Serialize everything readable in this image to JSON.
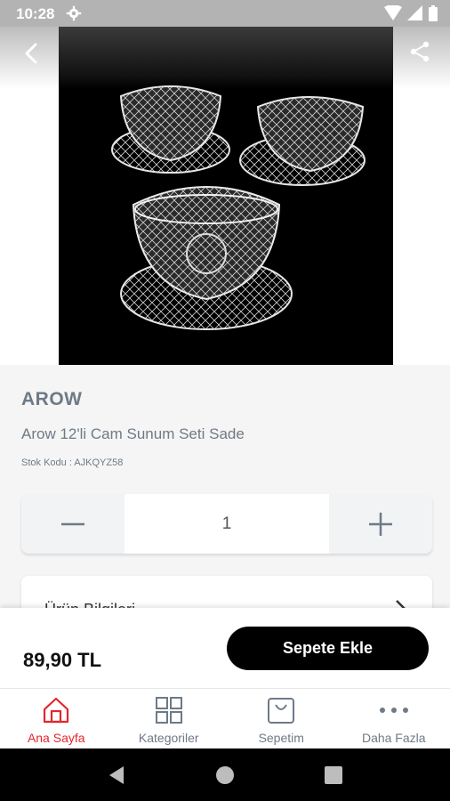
{
  "status": {
    "time": "10:28"
  },
  "product": {
    "brand": "AROW",
    "name": "Arow 12'li Cam Sunum Seti Sade",
    "stock": "Stok Kodu : AJKQYZ58",
    "quantity": "1",
    "info_label": "Ürün Bilgileri",
    "price": "89,90 TL",
    "add_to_cart": "Sepete Ekle"
  },
  "tabs": [
    {
      "label": "Ana Sayfa",
      "icon": "home-icon"
    },
    {
      "label": "Kategoriler",
      "icon": "grid-icon"
    },
    {
      "label": "Sepetim",
      "icon": "bag-icon"
    },
    {
      "label": "Daha Fazla",
      "icon": "more-icon"
    }
  ],
  "colors": {
    "accent": "#e3262d",
    "text_muted": "#6e7a86",
    "button": "#000000"
  }
}
